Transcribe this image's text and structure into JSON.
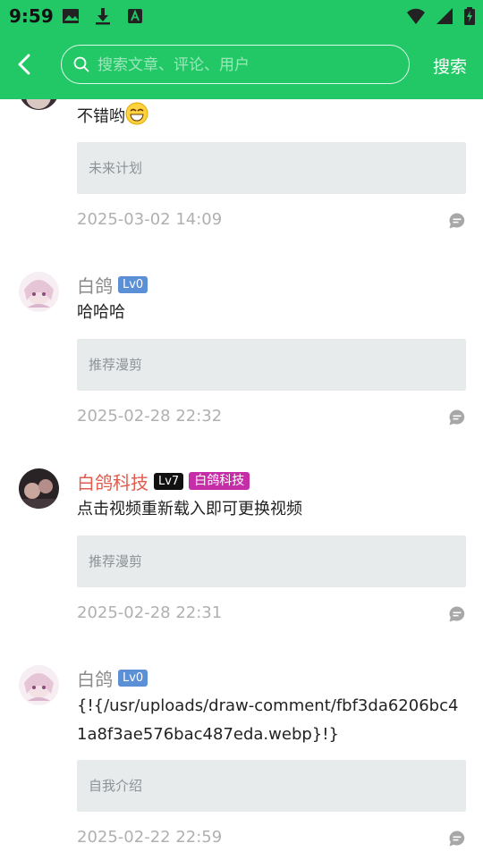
{
  "status_bar": {
    "time": "9:59"
  },
  "header": {
    "search_placeholder": "搜索文章、评论、用户",
    "search_button": "搜索"
  },
  "comments": [
    {
      "name": "",
      "content": "不错哟",
      "reference": "未来计划",
      "date": "2025-03-02 14:09"
    },
    {
      "name": "白鸽",
      "level": "Lv0",
      "content": "哈哈哈",
      "reference": "推荐漫剪",
      "date": "2025-02-28 22:32"
    },
    {
      "name": "白鸽科技",
      "level": "Lv7",
      "title_badge": "白鸽科技",
      "content": "点击视频重新载入即可更换视频",
      "reference": "推荐漫剪",
      "date": "2025-02-28 22:31"
    },
    {
      "name": "白鸽",
      "level": "Lv0",
      "content": "{!{/usr/uploads/draw-comment/fbf3da6206bc41a8f3ae576bac487eda.webp}!}",
      "reference": "自我介绍",
      "date": "2025-02-22 22:59"
    }
  ],
  "colors": {
    "header_bg": "#22c866",
    "level_badge": "#5b8fd6",
    "level_badge_high": "#111111",
    "title_badge": "#c62ea8",
    "vip_name": "#e25a4c"
  }
}
